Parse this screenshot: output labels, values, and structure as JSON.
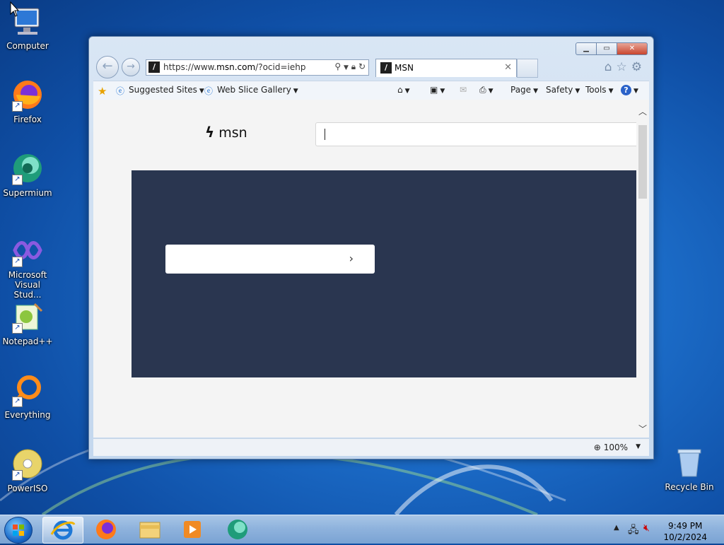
{
  "desktop": {
    "icons": [
      {
        "label": "Computer",
        "icon": "computer-icon"
      },
      {
        "label": "Firefox",
        "icon": "firefox-icon"
      },
      {
        "label": "Supermium",
        "icon": "supermium-icon"
      },
      {
        "label": "Microsoft Visual Stud...",
        "icon": "visual-studio-icon"
      },
      {
        "label": "Notepad++",
        "icon": "notepadpp-icon"
      },
      {
        "label": "Everything",
        "icon": "everything-icon"
      },
      {
        "label": "PowerISO",
        "icon": "poweriso-icon"
      },
      {
        "label": "Recycle Bin",
        "icon": "recycle-bin-icon"
      }
    ]
  },
  "browser": {
    "address_url_prefix": "https://www.",
    "address_url_domain": "msn.com",
    "address_url_suffix": "/?ocid=iehp",
    "tab_title": "MSN",
    "favorites_bar": {
      "suggested_sites": "Suggested Sites",
      "web_slice_gallery": "Web Slice Gallery"
    },
    "command_bar": {
      "page": "Page",
      "safety": "Safety",
      "tools": "Tools"
    },
    "status": {
      "zoom": "100%"
    }
  },
  "msn_page": {
    "logo_text": "msn",
    "search_value": ""
  },
  "taskbar": {
    "time": "9:49 PM",
    "date": "10/2/2024"
  },
  "colors": {
    "hero_bg": "#2a3650",
    "desktop_bg": "#1c6dc9"
  }
}
